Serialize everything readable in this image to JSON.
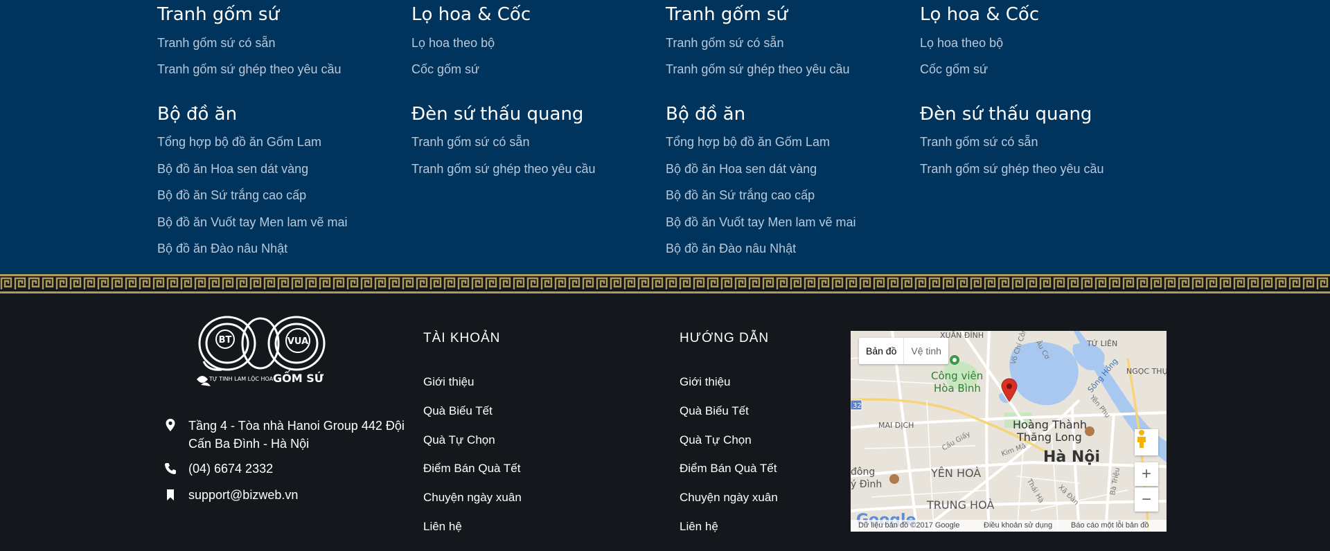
{
  "menu": {
    "columns": [
      {
        "groups": [
          {
            "title": "Tranh gốm sứ",
            "links": [
              "Tranh gốm sứ có sẵn",
              "Tranh gốm sứ ghép theo yêu cầu"
            ]
          },
          {
            "title": "Bộ đồ ăn",
            "links": [
              "Tổng hợp bộ đồ ăn Gốm Lam",
              "Bộ đồ ăn Hoa sen dát vàng",
              "Bộ đồ ăn Sứ trắng cao cấp",
              "Bộ đồ ăn Vuốt tay Men lam vẽ mai",
              "Bộ đồ ăn Đào nâu Nhật"
            ]
          }
        ]
      },
      {
        "groups": [
          {
            "title": "Lọ hoa & Cốc",
            "links": [
              "Lọ hoa theo bộ",
              "Cốc gốm sứ"
            ]
          },
          {
            "title": "Đèn sứ thấu quang",
            "links": [
              "Tranh gốm sứ có sẵn",
              "Tranh gốm sứ ghép theo yêu cầu"
            ]
          }
        ]
      },
      {
        "groups": [
          {
            "title": "Tranh gốm sứ",
            "links": [
              "Tranh gốm sứ có sẵn",
              "Tranh gốm sứ ghép theo yêu cầu"
            ]
          },
          {
            "title": "Bộ đồ ăn",
            "links": [
              "Tổng hợp bộ đồ ăn Gốm Lam",
              "Bộ đồ ăn Hoa sen dát vàng",
              "Bộ đồ ăn Sứ trắng cao cấp",
              "Bộ đồ ăn Vuốt tay Men lam vẽ mai",
              "Bộ đồ ăn Đào nâu Nhật"
            ]
          }
        ]
      },
      {
        "groups": [
          {
            "title": "Lọ hoa & Cốc",
            "links": [
              "Lọ hoa theo bộ",
              "Cốc gốm sứ"
            ]
          },
          {
            "title": "Đèn sứ thấu quang",
            "links": [
              "Tranh gốm sứ có sẵn",
              "Tranh gốm sứ ghép theo yêu cầu"
            ]
          }
        ]
      }
    ]
  },
  "logo": {
    "badge_left": "BT",
    "badge_right": "VUA",
    "tagline": "TỰ TINH LAM LỘC HOA",
    "brand": "GỐM SỨ"
  },
  "contact": {
    "address_line1": "Tầng 4 - Tòa nhà Hanoi Group 442 Đội",
    "address_line2": "Cấn Ba Đình - Hà Nội",
    "phone": "(04) 6674 2332",
    "email": "support@bizweb.vn"
  },
  "account": {
    "heading": "TÀI KHOẢN",
    "links": [
      "Giới thiệu",
      "Quà Biếu Tết",
      "Quà Tự Chọn",
      "Điểm Bán Quà Tết",
      "Chuyện ngày xuân",
      "Liên hệ"
    ]
  },
  "guide": {
    "heading": "HƯỚNG DẪN",
    "links": [
      "Giới thiệu",
      "Quà Biếu Tết",
      "Quà Tự Chọn",
      "Điểm Bán Quà Tết",
      "Chuyện ngày xuân",
      "Liên hệ"
    ]
  },
  "map": {
    "type_map": "Bản đồ",
    "type_satellite": "Vệ tinh",
    "labels": {
      "xuan_dinh": "XUÂN ĐỈNH",
      "tu_lien": "TỨ LIÊN",
      "ngoc_thuy": "NGỌC THỤY",
      "cong_vien": "Công viên",
      "hoa_binh": "Hòa Bình",
      "mai_dich": "MAI DỊCH",
      "hoang_thanh": "Hoàng Thành",
      "thang_long": "Thăng Long",
      "ha_noi": "Hà Nội",
      "yen_hoa": "YÊN HOÀ",
      "trung_hoa": "TRUNG HOÀ",
      "dong_dinh": "đông",
      "y_dinh": "ý Đình",
      "song_hong": "Sông Hồng",
      "cau_giay": "Cầu Giấy",
      "kim_ma": "Kim Mã",
      "yen_phu": "Yên Phụ",
      "vo_chi_cong": "Võ Chí Công",
      "au_co": "Âu Cơ",
      "thai_ha": "Thái Hà",
      "xa_dan": "Xã Đàn",
      "ba_trieu": "Bà Triệu",
      "route_shield": "32"
    },
    "zoom_in": "+",
    "zoom_out": "−",
    "google": "Google",
    "attribution": "Dữ liệu bản đồ ©2017 Google",
    "terms": "Điều khoản sử dụng",
    "report": "Báo cáo một lỗi bản đồ",
    "colors": {
      "water": "#a8c8f0",
      "park": "#c8e6c0",
      "land": "#e8e4dc",
      "road": "#ffffff",
      "pin": "#d93025"
    }
  },
  "theme": {
    "menu_bg": "#00345c",
    "footer_bg": "#14171c",
    "key_gold": "#b09a5a"
  }
}
